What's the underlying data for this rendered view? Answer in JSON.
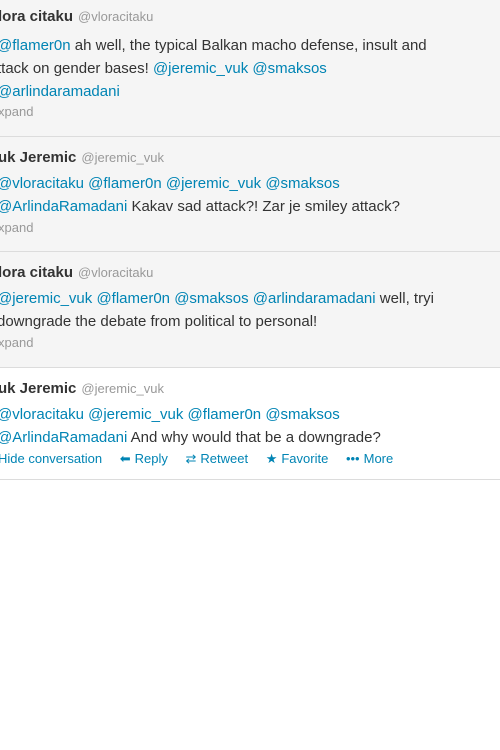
{
  "tweets": [
    {
      "name": "lora citaku",
      "handle": "@vloracitaku",
      "line1": {
        "m1": "@flamer0n",
        "t1": " ah well, the typical Balkan macho defense, insult and"
      },
      "line2": {
        "t1": "ttack on gender bases! ",
        "m1": "@jeremic_vuk",
        "m2": "@smaksos"
      },
      "line3": {
        "m1": "@arlindaramadani"
      },
      "expand": "xpand"
    },
    {
      "name": "uk Jeremic",
      "handle": "@jeremic_vuk",
      "line1": {
        "m1": "@vloracitaku",
        "m2": "@flamer0n",
        "m3": "@jeremic_vuk",
        "m4": "@smaksos"
      },
      "line2": {
        "m1": "@ArlindaRamadani",
        "t1": " Kakav sad attack?! Zar je smiley attack?"
      },
      "expand": "xpand"
    },
    {
      "name": "lora citaku",
      "handle": "@vloracitaku",
      "line1": {
        "m1": "@jeremic_vuk",
        "m2": "@flamer0n",
        "m3": "@smaksos",
        "m4": "@arlindaramadani",
        "t1": " well, tryi"
      },
      "line2": {
        "t1": "downgrade the debate from political to personal!"
      },
      "expand": "xpand"
    },
    {
      "name": "uk Jeremic",
      "handle": "@jeremic_vuk",
      "line1": {
        "m1": "@vloracitaku",
        "m2": "@jeremic_vuk",
        "m3": "@flamer0n",
        "m4": "@smaksos"
      },
      "line2": {
        "m1": "@ArlindaRamadani",
        "t1": " And why would that be a downgrade?"
      },
      "actions": {
        "hide": "Hide conversation",
        "reply": "Reply",
        "retweet": "Retweet",
        "favorite": "Favorite",
        "more": "More"
      },
      "icons": {
        "reply": "reply-arrow-icon",
        "retweet": "retweet-icon",
        "favorite": "star-icon",
        "more": "ellipsis-icon"
      }
    }
  ],
  "colors": {
    "mention": "#0084b4",
    "muted": "#999999",
    "text": "#333333",
    "row_gray": "#f5f5f5",
    "divider": "#dcdcdc"
  }
}
